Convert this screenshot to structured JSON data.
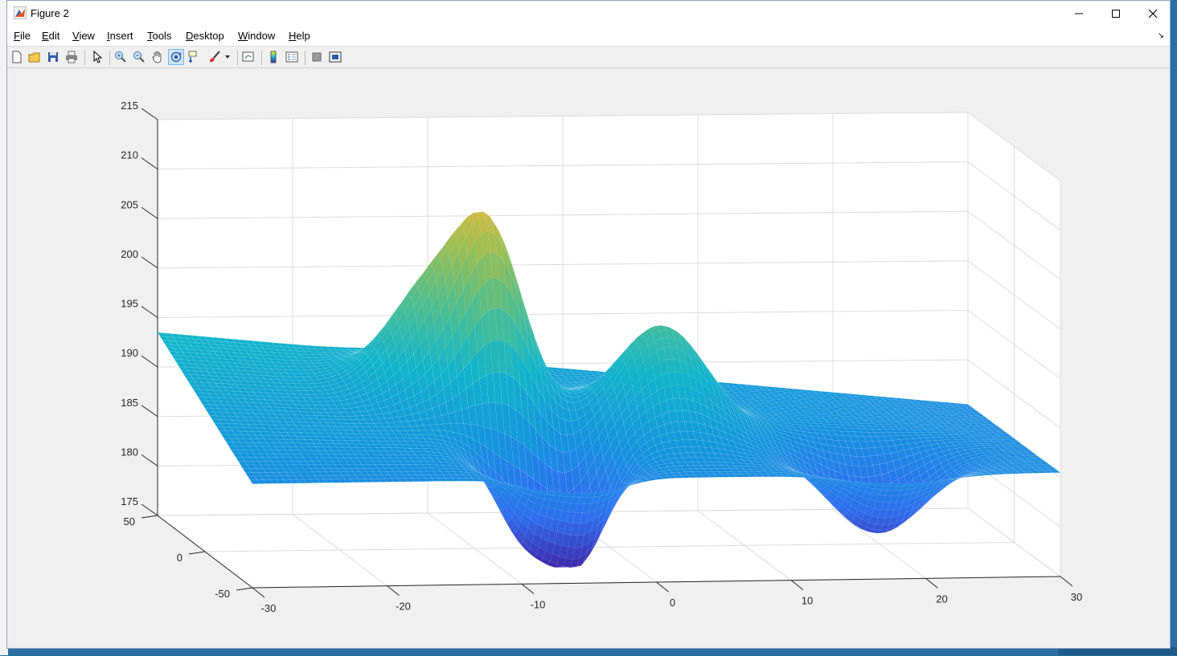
{
  "window": {
    "title": "Figure 2",
    "controls": [
      "minimize",
      "maximize",
      "close"
    ]
  },
  "menu": [
    {
      "label": "File",
      "key": "F",
      "rest": "ile"
    },
    {
      "label": "Edit",
      "key": "E",
      "rest": "dit"
    },
    {
      "label": "View",
      "key": "V",
      "rest": "iew"
    },
    {
      "label": "Insert",
      "key": "I",
      "rest": "nsert"
    },
    {
      "label": "Tools",
      "key": "T",
      "rest": "ools"
    },
    {
      "label": "Desktop",
      "key": "D",
      "rest": "esktop"
    },
    {
      "label": "Window",
      "key": "W",
      "rest": "indow"
    },
    {
      "label": "Help",
      "key": "H",
      "rest": "elp"
    }
  ],
  "toolbar": [
    "new-figure-icon",
    "open-file-icon",
    "save-icon",
    "print-icon",
    "edit-plot-arrow-icon",
    "zoom-in-icon",
    "zoom-out-icon",
    "pan-hand-icon",
    "rotate-3d-icon",
    "data-cursor-icon",
    "brush-icon",
    "brush-dropdown-icon",
    "link-plot-icon",
    "colorbar-icon",
    "legend-icon",
    "hide-plot-tools-icon",
    "show-plot-tools-icon"
  ],
  "colors": {
    "surface_low": "#3e26a8",
    "surface_mid": "#12b5cb",
    "surface_high": "#f9fb0e",
    "accent_toggle": "#cfe3f5"
  },
  "chart_data": {
    "type": "surface",
    "colormap": "parula",
    "grid": true,
    "xlim": [
      -30,
      30
    ],
    "ylim": [
      -50,
      50
    ],
    "zlim": [
      175,
      215
    ],
    "x_ticks": [
      "-30",
      "-20",
      "-10",
      "0",
      "10",
      "20",
      "30"
    ],
    "y_ticks": [
      "-50",
      "0",
      "50"
    ],
    "z_ticks": [
      "215",
      "210",
      "205",
      "200",
      "195",
      "190",
      "185",
      "180",
      "175"
    ],
    "features": [
      {
        "kind": "peak",
        "x": -9,
        "z": 206.5
      },
      {
        "kind": "peak",
        "x": -12,
        "z": 204.5
      },
      {
        "kind": "peak",
        "x": 3,
        "z": 198.5
      },
      {
        "kind": "trough",
        "x": -9,
        "z": 176.5
      },
      {
        "kind": "trough",
        "x": -5,
        "z": 175.5
      },
      {
        "kind": "trough",
        "x": 18,
        "z": 177.5
      }
    ]
  }
}
